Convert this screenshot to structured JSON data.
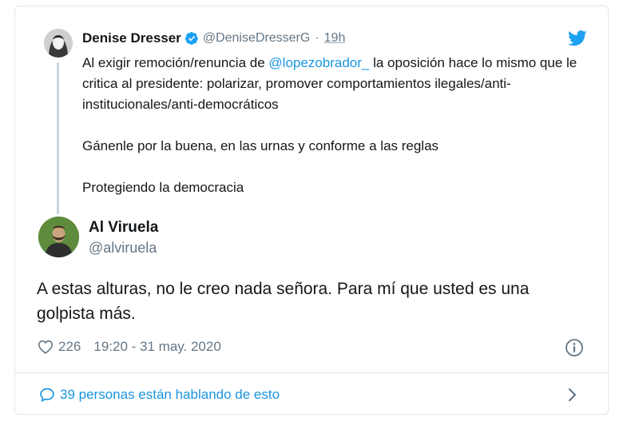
{
  "parent_tweet": {
    "author_name": "Denise Dresser",
    "handle": "@DeniseDresserG",
    "separator": "·",
    "time": "19h",
    "text_before_mention": "Al exigir remoción/renuncia de ",
    "mention": "@lopezobrador_",
    "text_after_mention": " la oposición hace lo mismo que le critica al presidente: polarizar, promover comportamientos ilegales/anti-institucionales/anti-democráticos",
    "paragraph_2": "Gánenle por la buena, en las urnas y conforme a las reglas",
    "paragraph_3": "Protegiendo la democracia"
  },
  "reply_tweet": {
    "author_name": "Al Viruela",
    "handle": "@alviruela",
    "text": "A estas alturas, no le creo nada señora. Para mí que usted es una golpista más.",
    "likes": "226",
    "timestamp": "19:20 - 31 may. 2020"
  },
  "footer": {
    "conversation_label": "39 personas están hablando de esto"
  },
  "icons": {
    "verified": "verified-badge-icon",
    "twitter": "twitter-bird-icon",
    "like": "heart-icon",
    "info": "info-icon",
    "conversation": "speech-bubble-icon",
    "chevron": "chevron-right-icon"
  },
  "colors": {
    "twitter_blue": "#1da1f2",
    "link_blue": "#1b95e0",
    "secondary_text": "#657786",
    "border": "#e1e8ed"
  }
}
